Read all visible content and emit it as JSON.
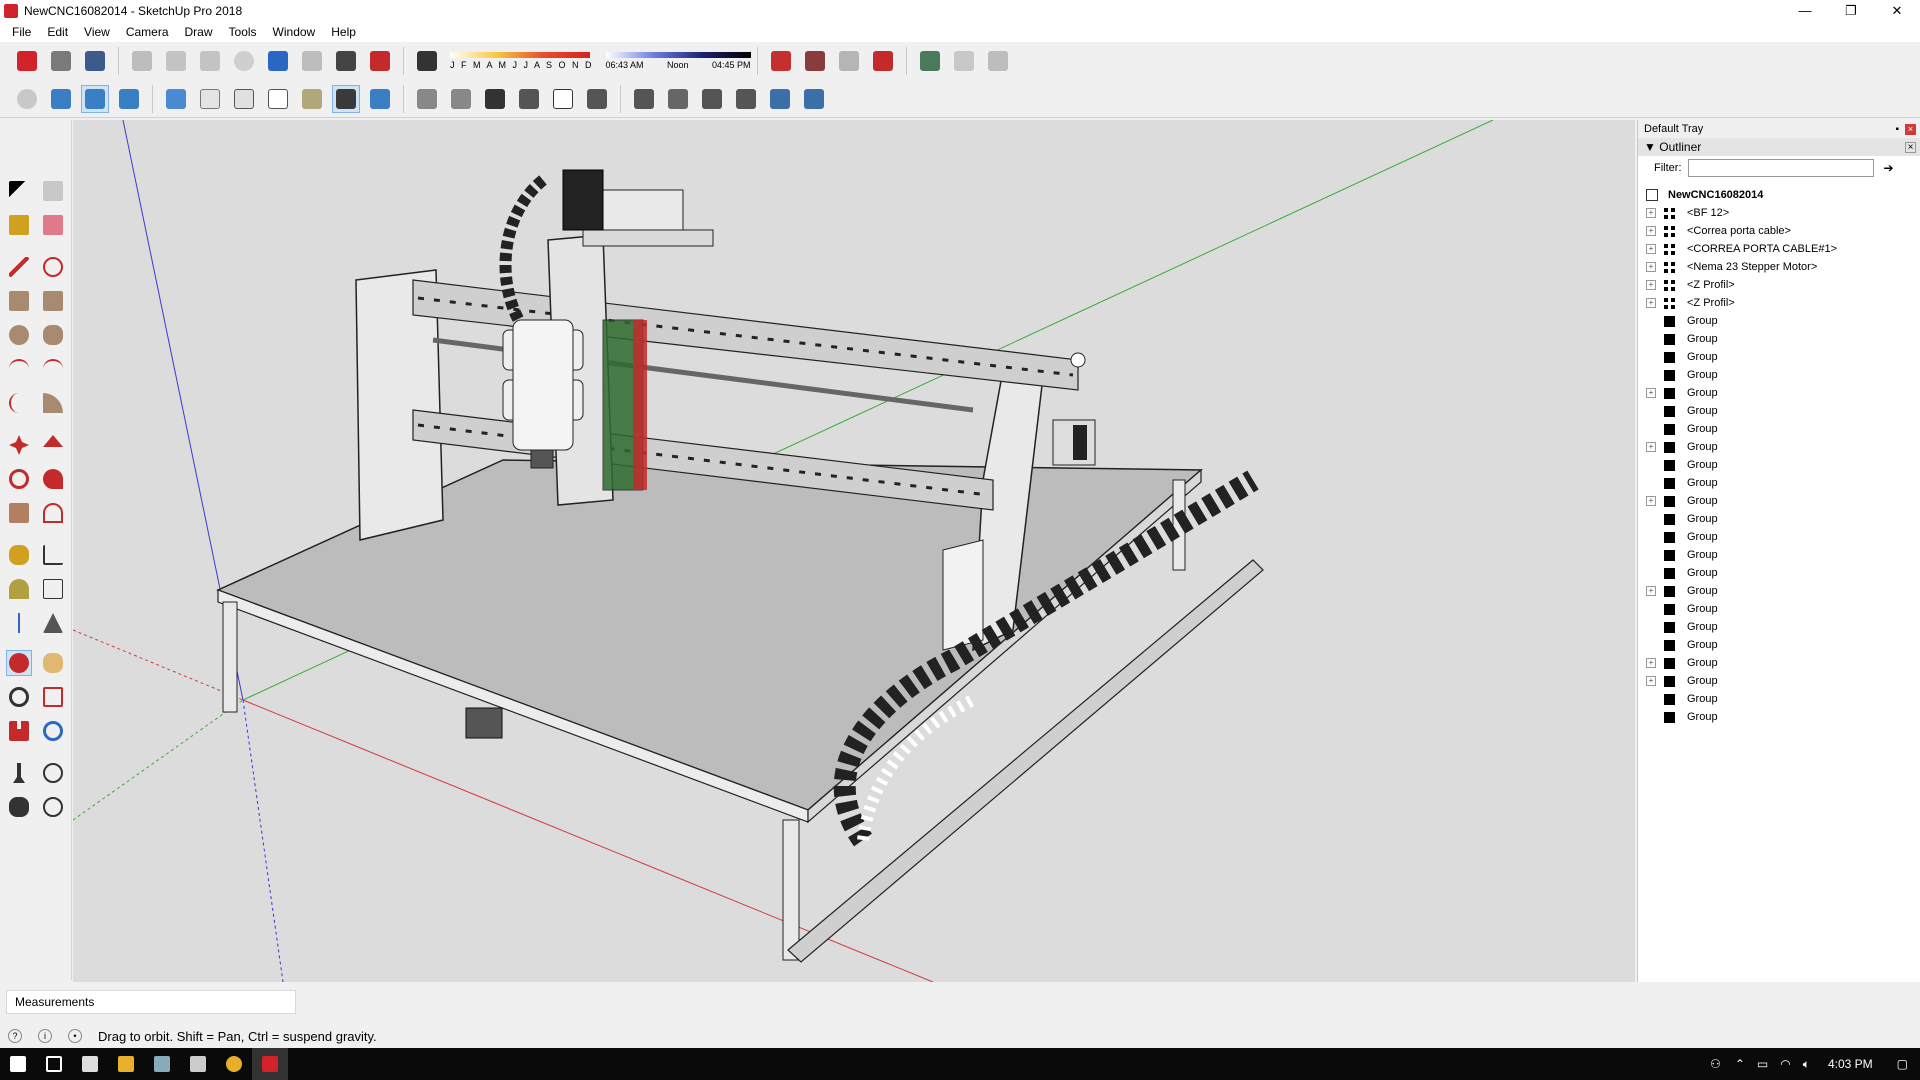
{
  "window": {
    "title": "NewCNC16082014 - SketchUp Pro 2018",
    "minimize": "—",
    "restore": "❐",
    "close": "✕"
  },
  "menu": [
    "File",
    "Edit",
    "View",
    "Camera",
    "Draw",
    "Tools",
    "Window",
    "Help"
  ],
  "shadows": {
    "months": "J F M A M J J A S O N D",
    "time_left": "06:43 AM",
    "time_mid": "Noon",
    "time_right": "04:45 PM"
  },
  "tray": {
    "title": "Default Tray",
    "panel": "Outliner",
    "filter_label": "Filter:",
    "filter_value": "",
    "root": "NewCNC16082014",
    "items": [
      {
        "label": "<BF 12>",
        "type": "component",
        "expandable": true
      },
      {
        "label": "<Correa porta cable>",
        "type": "component",
        "expandable": true
      },
      {
        "label": "<CORREA PORTA CABLE#1>",
        "type": "component",
        "expandable": true
      },
      {
        "label": "<Nema 23 Stepper Motor>",
        "type": "component",
        "expandable": true
      },
      {
        "label": "<Z Profil>",
        "type": "component",
        "expandable": true
      },
      {
        "label": "<Z Profil>",
        "type": "component",
        "expandable": true
      },
      {
        "label": "Group",
        "type": "group",
        "expandable": false
      },
      {
        "label": "Group",
        "type": "group",
        "expandable": false
      },
      {
        "label": "Group",
        "type": "group",
        "expandable": false
      },
      {
        "label": "Group",
        "type": "group",
        "expandable": false
      },
      {
        "label": "Group",
        "type": "group",
        "expandable": true
      },
      {
        "label": "Group",
        "type": "group",
        "expandable": false
      },
      {
        "label": "Group",
        "type": "group",
        "expandable": false
      },
      {
        "label": "Group",
        "type": "group",
        "expandable": true
      },
      {
        "label": "Group",
        "type": "group",
        "expandable": false
      },
      {
        "label": "Group",
        "type": "group",
        "expandable": false
      },
      {
        "label": "Group",
        "type": "group",
        "expandable": true
      },
      {
        "label": "Group",
        "type": "group",
        "expandable": false
      },
      {
        "label": "Group",
        "type": "group",
        "expandable": false
      },
      {
        "label": "Group",
        "type": "group",
        "expandable": false
      },
      {
        "label": "Group",
        "type": "group",
        "expandable": false
      },
      {
        "label": "Group",
        "type": "group",
        "expandable": true
      },
      {
        "label": "Group",
        "type": "group",
        "expandable": false
      },
      {
        "label": "Group",
        "type": "group",
        "expandable": false
      },
      {
        "label": "Group",
        "type": "group",
        "expandable": false
      },
      {
        "label": "Group",
        "type": "group",
        "expandable": true
      },
      {
        "label": "Group",
        "type": "group",
        "expandable": true
      },
      {
        "label": "Group",
        "type": "group",
        "expandable": false
      },
      {
        "label": "Group",
        "type": "group",
        "expandable": false
      }
    ]
  },
  "measurements_label": "Measurements",
  "status_message": "Drag to orbit. Shift = Pan, Ctrl = suspend gravity.",
  "clock": "4:03 PM",
  "colors": {
    "red_axis": "#d23a3a",
    "green_axis": "#3aaa3a",
    "blue_axis": "#3a3ad2",
    "sky": "#dcdcdc"
  }
}
